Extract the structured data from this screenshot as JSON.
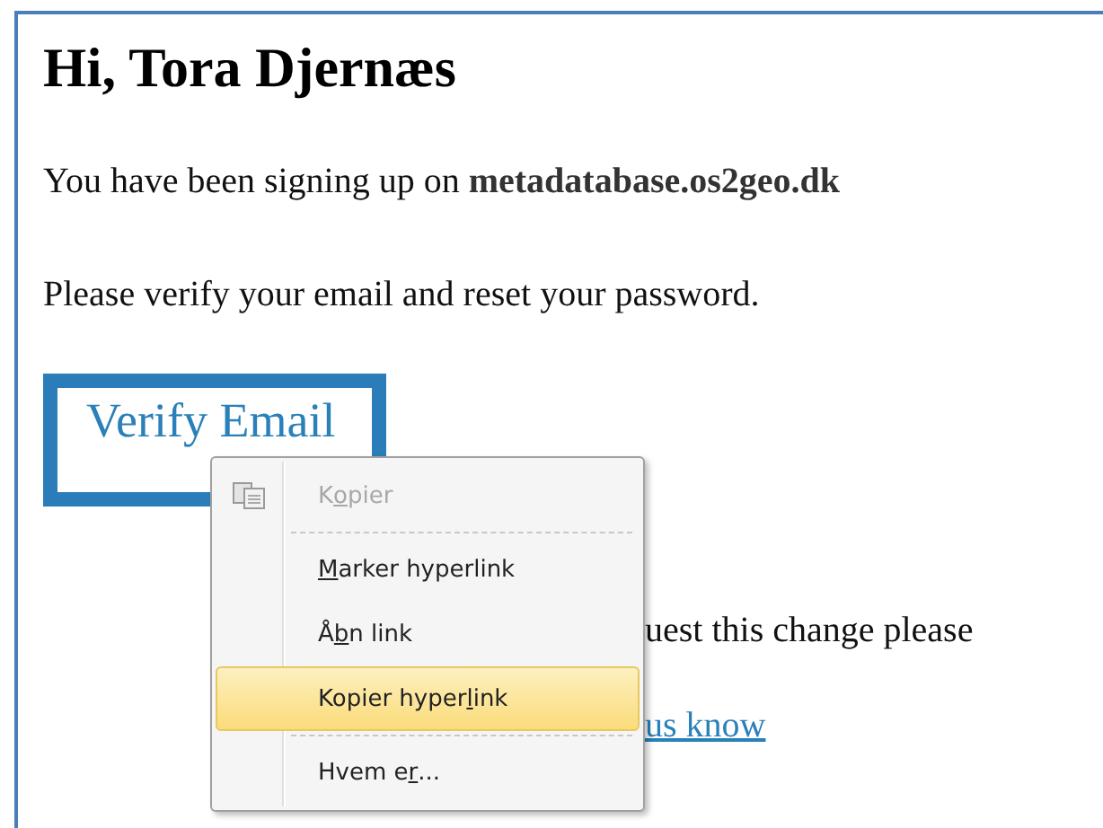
{
  "email": {
    "greeting": "Hi, Tora Djernæs",
    "signup_text": "You have been signing up on **metadatabase.os2geo.dk**",
    "instruction": "Please verify your email and reset your password.",
    "button": "Verify Email",
    "partial_text": "uest this change please",
    "partial_link": "us know"
  },
  "context_menu": {
    "items": [
      {
        "kind": "icon_item",
        "pre": "K",
        "key": "o",
        "post": "pier",
        "disabled": true,
        "selected": false
      },
      {
        "kind": "separator"
      },
      {
        "kind": "item",
        "key": "M",
        "post": "arker hyperlink",
        "disabled": false,
        "selected": false
      },
      {
        "kind": "item",
        "pre": "Å",
        "key": "b",
        "post": "n link",
        "disabled": false,
        "selected": false
      },
      {
        "kind": "item",
        "pre": "Kopier hyper",
        "key": "l",
        "post": "ink",
        "disabled": false,
        "selected": true
      },
      {
        "kind": "separator"
      },
      {
        "kind": "item",
        "pre": "Hvem e",
        "key": "r",
        "post": "...",
        "disabled": false,
        "selected": false
      }
    ]
  }
}
